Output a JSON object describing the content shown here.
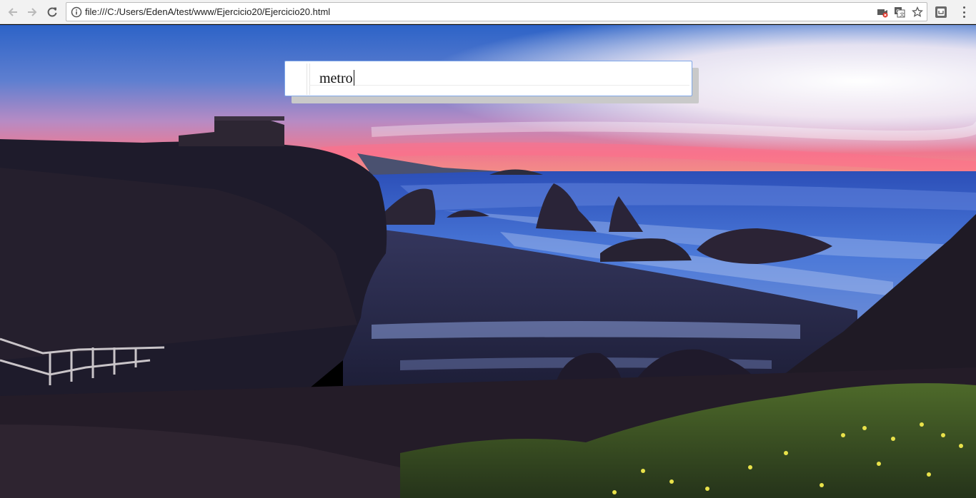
{
  "browser": {
    "url": "file:///C:/Users/EdenA/test/www/Ejercicio20/Ejercicio20.html"
  },
  "page": {
    "search_value": "metro"
  },
  "colors": {
    "toolbar": "#f2f2f2",
    "search_border": "#7fa6e8"
  }
}
